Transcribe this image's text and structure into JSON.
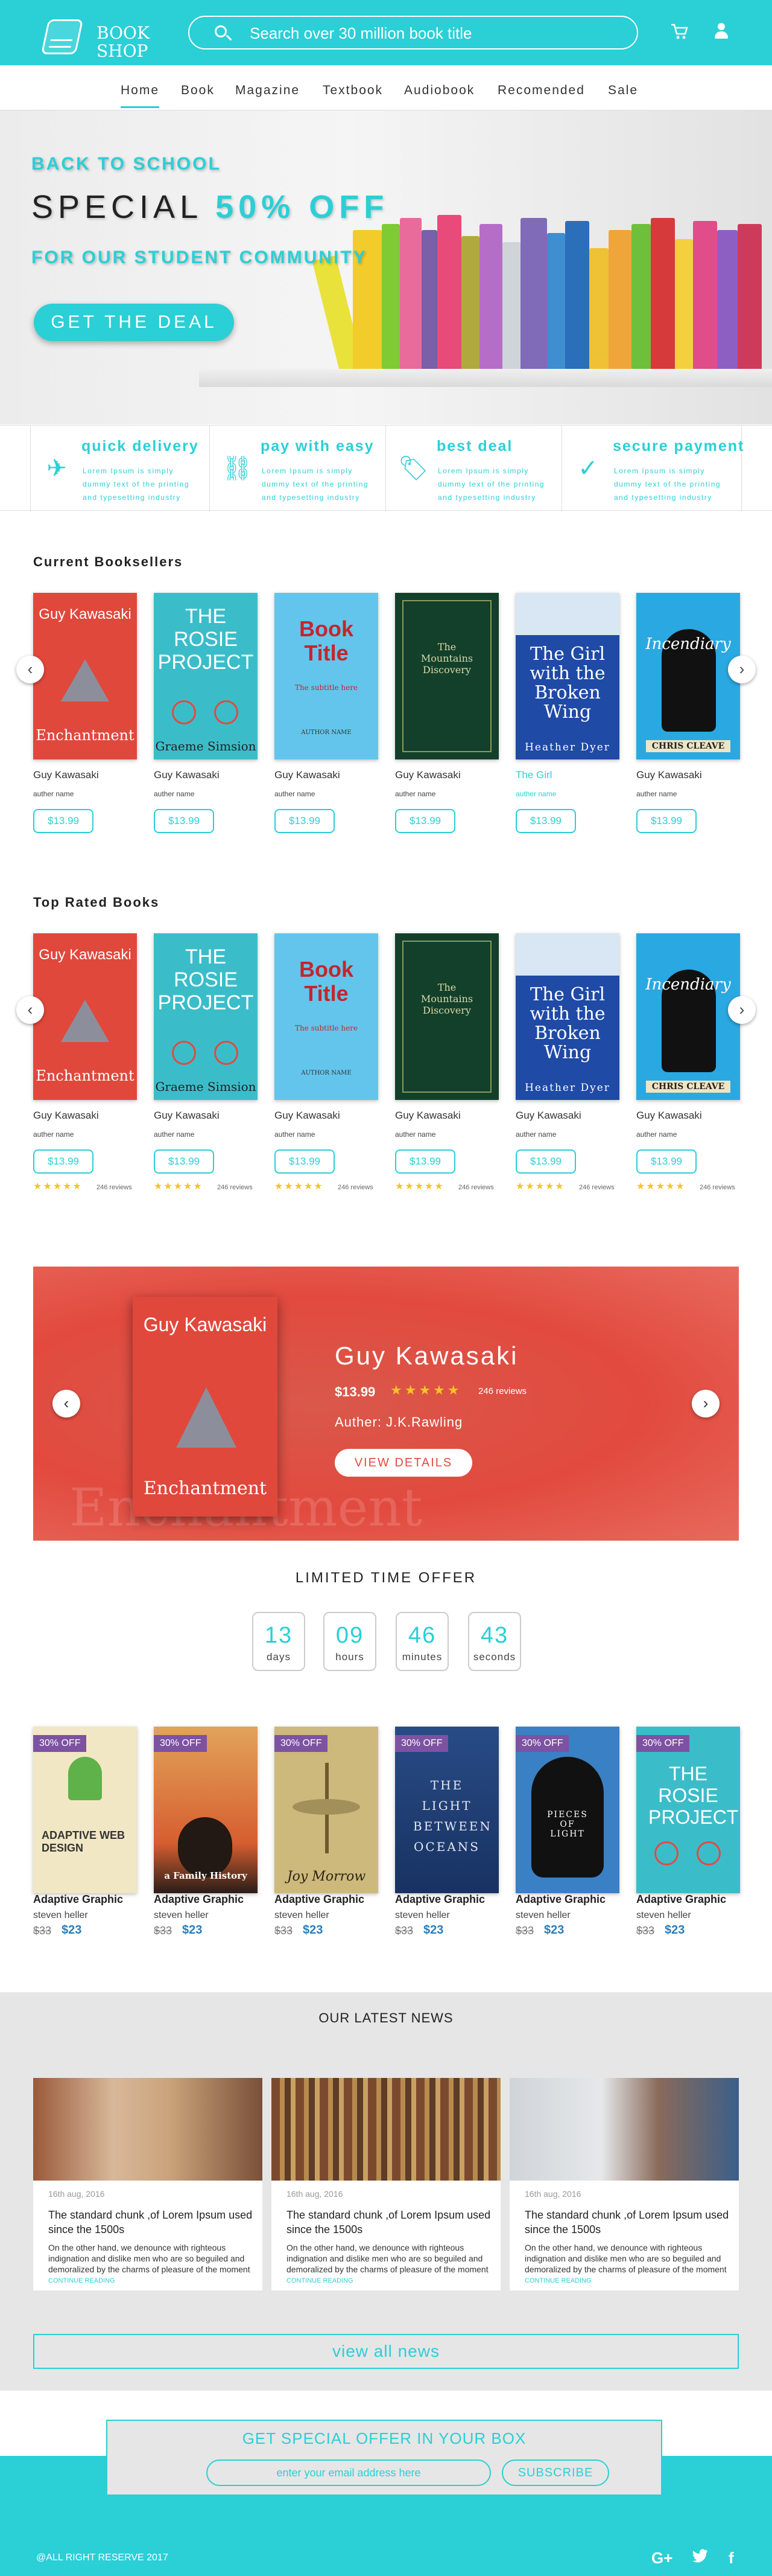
{
  "brand": {
    "logo_line1": "BOOK",
    "logo_line2": "SHOP",
    "accent": "#2bcfd6"
  },
  "header": {
    "search_placeholder": "Search over 30 million book title",
    "search_icon": "search-icon",
    "cart_icon": "cart-icon",
    "user_icon": "user-icon"
  },
  "nav": {
    "items": [
      "Home",
      "Book",
      "Magazine",
      "Textbook",
      "Audiobook",
      "Recomended",
      "Sale"
    ],
    "active": "Home"
  },
  "hero": {
    "line1": "BACK TO SCHOOL",
    "line2_a": "SPECIAL",
    "line2_b": "50% OFF",
    "line3": "FOR OUR STUDENT COMMUNITY",
    "cta": "GET THE DEAL"
  },
  "features": [
    {
      "title": "quick delivery",
      "desc": "Lorem Ipsum is simply dummy text of the printing and typesetting industry",
      "icon": "airplane-icon"
    },
    {
      "title": "pay with easy",
      "desc": "Lorem Ipsum is simply dummy text of the printing and typesetting industry",
      "icon": "link-icon"
    },
    {
      "title": "best deal",
      "desc": "Lorem Ipsum is simply dummy text of the printing and typesetting industry",
      "icon": "tag-icon"
    },
    {
      "title": "secure payment",
      "desc": "Lorem Ipsum is simply dummy text of the printing and typesetting industry",
      "icon": "check-icon"
    }
  ],
  "bestsellers": {
    "title": "Current Booksellers",
    "books": [
      {
        "cover_author": "Guy Kawasaki",
        "cover_title": "Enchantment",
        "title": "Guy Kawasaki",
        "author": "auther name",
        "price": "$13.99"
      },
      {
        "cover_author": "Graeme Simsion",
        "cover_title": "THE ROSIE PROJECT",
        "title": "Guy Kawasaki",
        "author": "auther name",
        "price": "$13.99"
      },
      {
        "cover_author": "AUTHOR NAME",
        "cover_title": "Book Title",
        "cover_sub": "The subtitle here",
        "title": "Guy Kawasaki",
        "author": "auther name",
        "price": "$13.99"
      },
      {
        "cover_author": "",
        "cover_title": "The Mountains Discovery",
        "title": "Guy Kawasaki",
        "author": "auther name",
        "price": "$13.99"
      },
      {
        "cover_author": "Heather Dyer",
        "cover_title": "The Girl with the Broken Wing",
        "title": "The Girl",
        "author": "auther name",
        "price": "$13.99"
      },
      {
        "cover_author": "CHRIS CLEAVE",
        "cover_title": "Incendiary",
        "title": "Guy Kawasaki",
        "author": "auther name",
        "price": "$13.99"
      }
    ]
  },
  "toprated": {
    "title": "Top Rated Books",
    "books": [
      {
        "title": "Guy Kawasaki",
        "author": "auther name",
        "price": "$13.99",
        "reviews": "246 reviews",
        "stars": 5
      },
      {
        "title": "Guy Kawasaki",
        "author": "auther name",
        "price": "$13.99",
        "reviews": "246 reviews",
        "stars": 5
      },
      {
        "title": "Guy Kawasaki",
        "author": "auther name",
        "price": "$13.99",
        "reviews": "246 reviews",
        "stars": 5
      },
      {
        "title": "Guy Kawasaki",
        "author": "auther name",
        "price": "$13.99",
        "reviews": "246 reviews",
        "stars": 5
      },
      {
        "title": "Guy Kawasaki",
        "author": "auther name",
        "price": "$13.99",
        "reviews": "246 reviews",
        "stars": 5
      },
      {
        "title": "Guy Kawasaki",
        "author": "auther name",
        "price": "$13.99",
        "reviews": "246 reviews",
        "stars": 5
      }
    ]
  },
  "banner": {
    "name": "Guy Kawasaki",
    "price": "$13.99",
    "stars": 5,
    "reviews": "246 reviews",
    "author_line": "Auther: J.K.Rawling",
    "cta": "VIEW DETAILS",
    "cover_author": "Guy Kawasaki",
    "cover_title": "Enchantment",
    "bg_word": "Enchantment"
  },
  "offer": {
    "title": "LIMITED TIME OFFER",
    "countdown": [
      {
        "value": "13",
        "label": "days"
      },
      {
        "value": "09",
        "label": "hours"
      },
      {
        "value": "46",
        "label": "minutes"
      },
      {
        "value": "43",
        "label": "seconds"
      }
    ],
    "books": [
      {
        "tag": "30% OFF",
        "cover_title": "ADAPTIVE WEB DESIGN",
        "title": "Adaptive Graphic",
        "author": "steven heller",
        "old_price": "$33",
        "new_price": "$23"
      },
      {
        "tag": "30% OFF",
        "cover_title": "a Family History",
        "title": "Adaptive Graphic",
        "author": "steven heller",
        "old_price": "$33",
        "new_price": "$23"
      },
      {
        "tag": "30% OFF",
        "cover_title": "Joy Morrow",
        "title": "Adaptive Graphic",
        "author": "steven heller",
        "old_price": "$33",
        "new_price": "$23"
      },
      {
        "tag": "30% OFF",
        "cover_title": "THE LIGHT BETWEEN OCEANS",
        "title": "Adaptive Graphic",
        "author": "steven heller",
        "old_price": "$33",
        "new_price": "$23"
      },
      {
        "tag": "30% OFF",
        "cover_title": "PIECES OF LIGHT",
        "title": "Adaptive Graphic",
        "author": "steven heller",
        "old_price": "$33",
        "new_price": "$23"
      },
      {
        "tag": "30% OFF",
        "cover_title": "THE ROSIE PROJECT",
        "title": "Adaptive Graphic",
        "author": "steven heller",
        "old_price": "$33",
        "new_price": "$23"
      }
    ]
  },
  "news": {
    "title": "OUR LATEST NEWS",
    "items": [
      {
        "date": "16th aug, 2016",
        "title": "The standard chunk ,of Lorem Ipsum used since the 1500s",
        "body": "On the other hand, we denounce with righteous indignation and dislike men who are so beguiled and demoralized by the charms of pleasure of the moment",
        "link": "CONTINUE READING"
      },
      {
        "date": "16th aug, 2016",
        "title": "The standard chunk ,of Lorem Ipsum used since the 1500s",
        "body": "On the other hand, we denounce with righteous indignation and dislike men who are so beguiled and demoralized by the charms of pleasure of the moment",
        "link": "CONTINUE READING"
      },
      {
        "date": "16th aug, 2016",
        "title": "The standard chunk ,of Lorem Ipsum used since the 1500s",
        "body": "On the other hand, we denounce with righteous indignation and dislike men who are so beguiled and demoralized by the charms of pleasure of the moment",
        "link": "CONTINUE READING"
      }
    ],
    "view_all": "view all news"
  },
  "newsletter": {
    "title": "GET SPECIAL OFFER IN YOUR BOX",
    "placeholder": "enter your email address here",
    "button": "SUBSCRIBE"
  },
  "footer": {
    "copyright": "@ALL RIGHT RESERVE 2017",
    "social": [
      "G+",
      "t",
      "f"
    ]
  }
}
